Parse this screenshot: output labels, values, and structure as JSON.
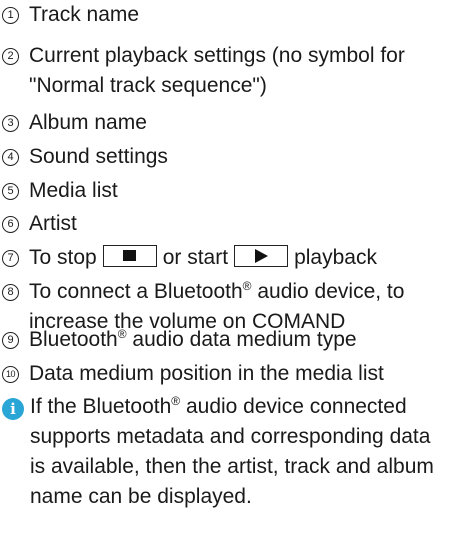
{
  "legend": [
    {
      "n": "1",
      "text": "Track name"
    },
    {
      "n": "2",
      "text": "Current playback settings (no symbol for",
      "text2": "\"Normal track sequence\")"
    },
    {
      "n": "3",
      "text": "Album name"
    },
    {
      "n": "4",
      "text": "Sound settings"
    },
    {
      "n": "5",
      "text": "Media list"
    },
    {
      "n": "6",
      "text": "Artist"
    },
    {
      "n": "7",
      "pre": "To stop",
      "mid": "or start",
      "post": "playback"
    },
    {
      "n": "8",
      "text": "To connect a Bluetooth",
      "text_tail": " audio device, to",
      "text2": "increase the volume on COMAND"
    },
    {
      "n": "9",
      "text": "Bluetooth",
      "text_tail": " audio data medium type"
    },
    {
      "n": "10",
      "text": "Data medium position in the media list"
    }
  ],
  "registered_mark": "®",
  "info": {
    "icon": "info-icon",
    "icon_color": "#2aa6d6",
    "line1_a": "If the Bluetooth",
    "line1_b": " audio device connected",
    "line2": "supports metadata and corresponding data",
    "line3": "is available, then the artist, track and album",
    "line4": "name can be displayed."
  }
}
